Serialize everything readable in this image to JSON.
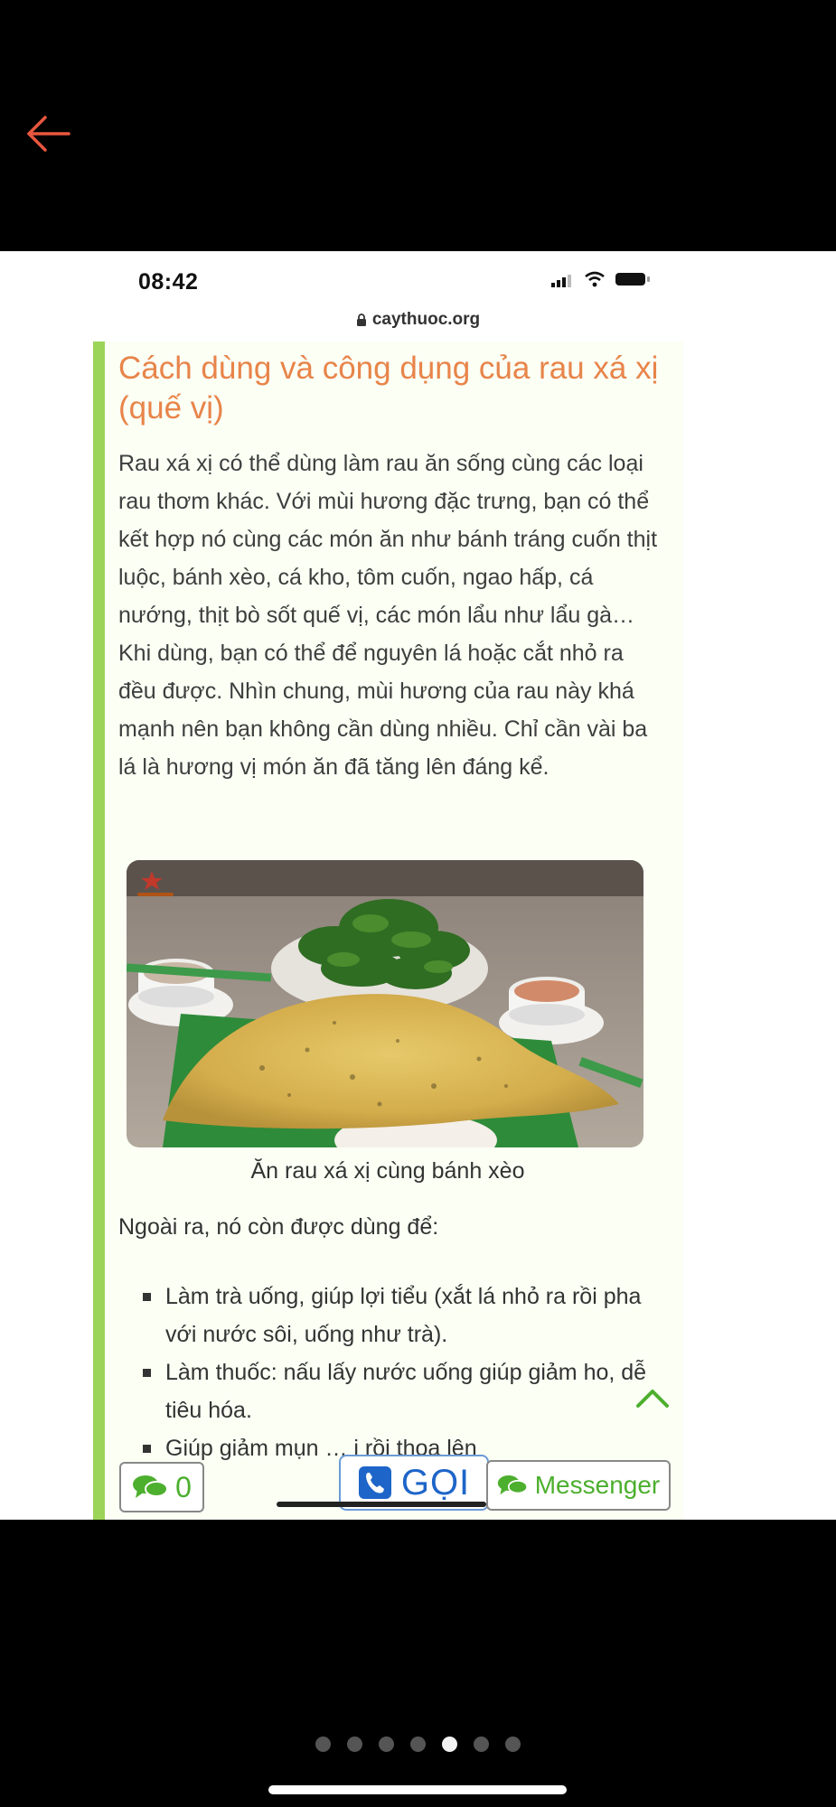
{
  "viewer": {
    "back_icon": "arrow-left-icon",
    "back_color": "#e9573f",
    "page_count": 7,
    "active_page_index": 4
  },
  "status_bar": {
    "time": "08:42"
  },
  "browser": {
    "url": "caythuoc.org"
  },
  "article": {
    "accent_color": "#9bd458",
    "heading": "Cách dùng và công dụng của rau xá xị (quế vị)",
    "heading_color": "#e8844a",
    "paragraph": "Rau xá xị có thể dùng làm rau ăn sống cùng các loại rau thơm khác. Với mùi hương đặc trưng, bạn có thể kết hợp nó cùng các món ăn như bánh tráng cuốn thịt luộc, bánh xèo, cá kho, tôm cuốn, ngao hấp, cá nướng, thịt bò sốt quế vị, các món lẩu như lẩu gà… Khi dùng, bạn có thể để nguyên lá hoặc cắt nhỏ ra đều được. Nhìn chung, mùi hương của rau này khá mạnh nên bạn không cần dùng nhiều. Chỉ cần vài ba lá là hương vị món ăn đã tăng lên đáng kể.",
    "image_caption": "Ăn rau xá xị cùng bánh xèo",
    "intro": "Ngoài ra, nó còn được dùng để:",
    "bullets": [
      "Làm trà uống, giúp lợi tiểu (xắt lá nhỏ ra rồi pha với nước sôi, uống như trà).",
      "Làm thuốc: nấu lấy nước uống giúp giảm ho, dễ tiêu hóa.",
      "Giúp giảm mụn … i rồi thoa lên"
    ]
  },
  "action_bar": {
    "chat_count": "0",
    "call_label": "GỌI",
    "messenger_label": "Messenger",
    "green": "#4caf2e",
    "blue": "#1e65c9"
  }
}
